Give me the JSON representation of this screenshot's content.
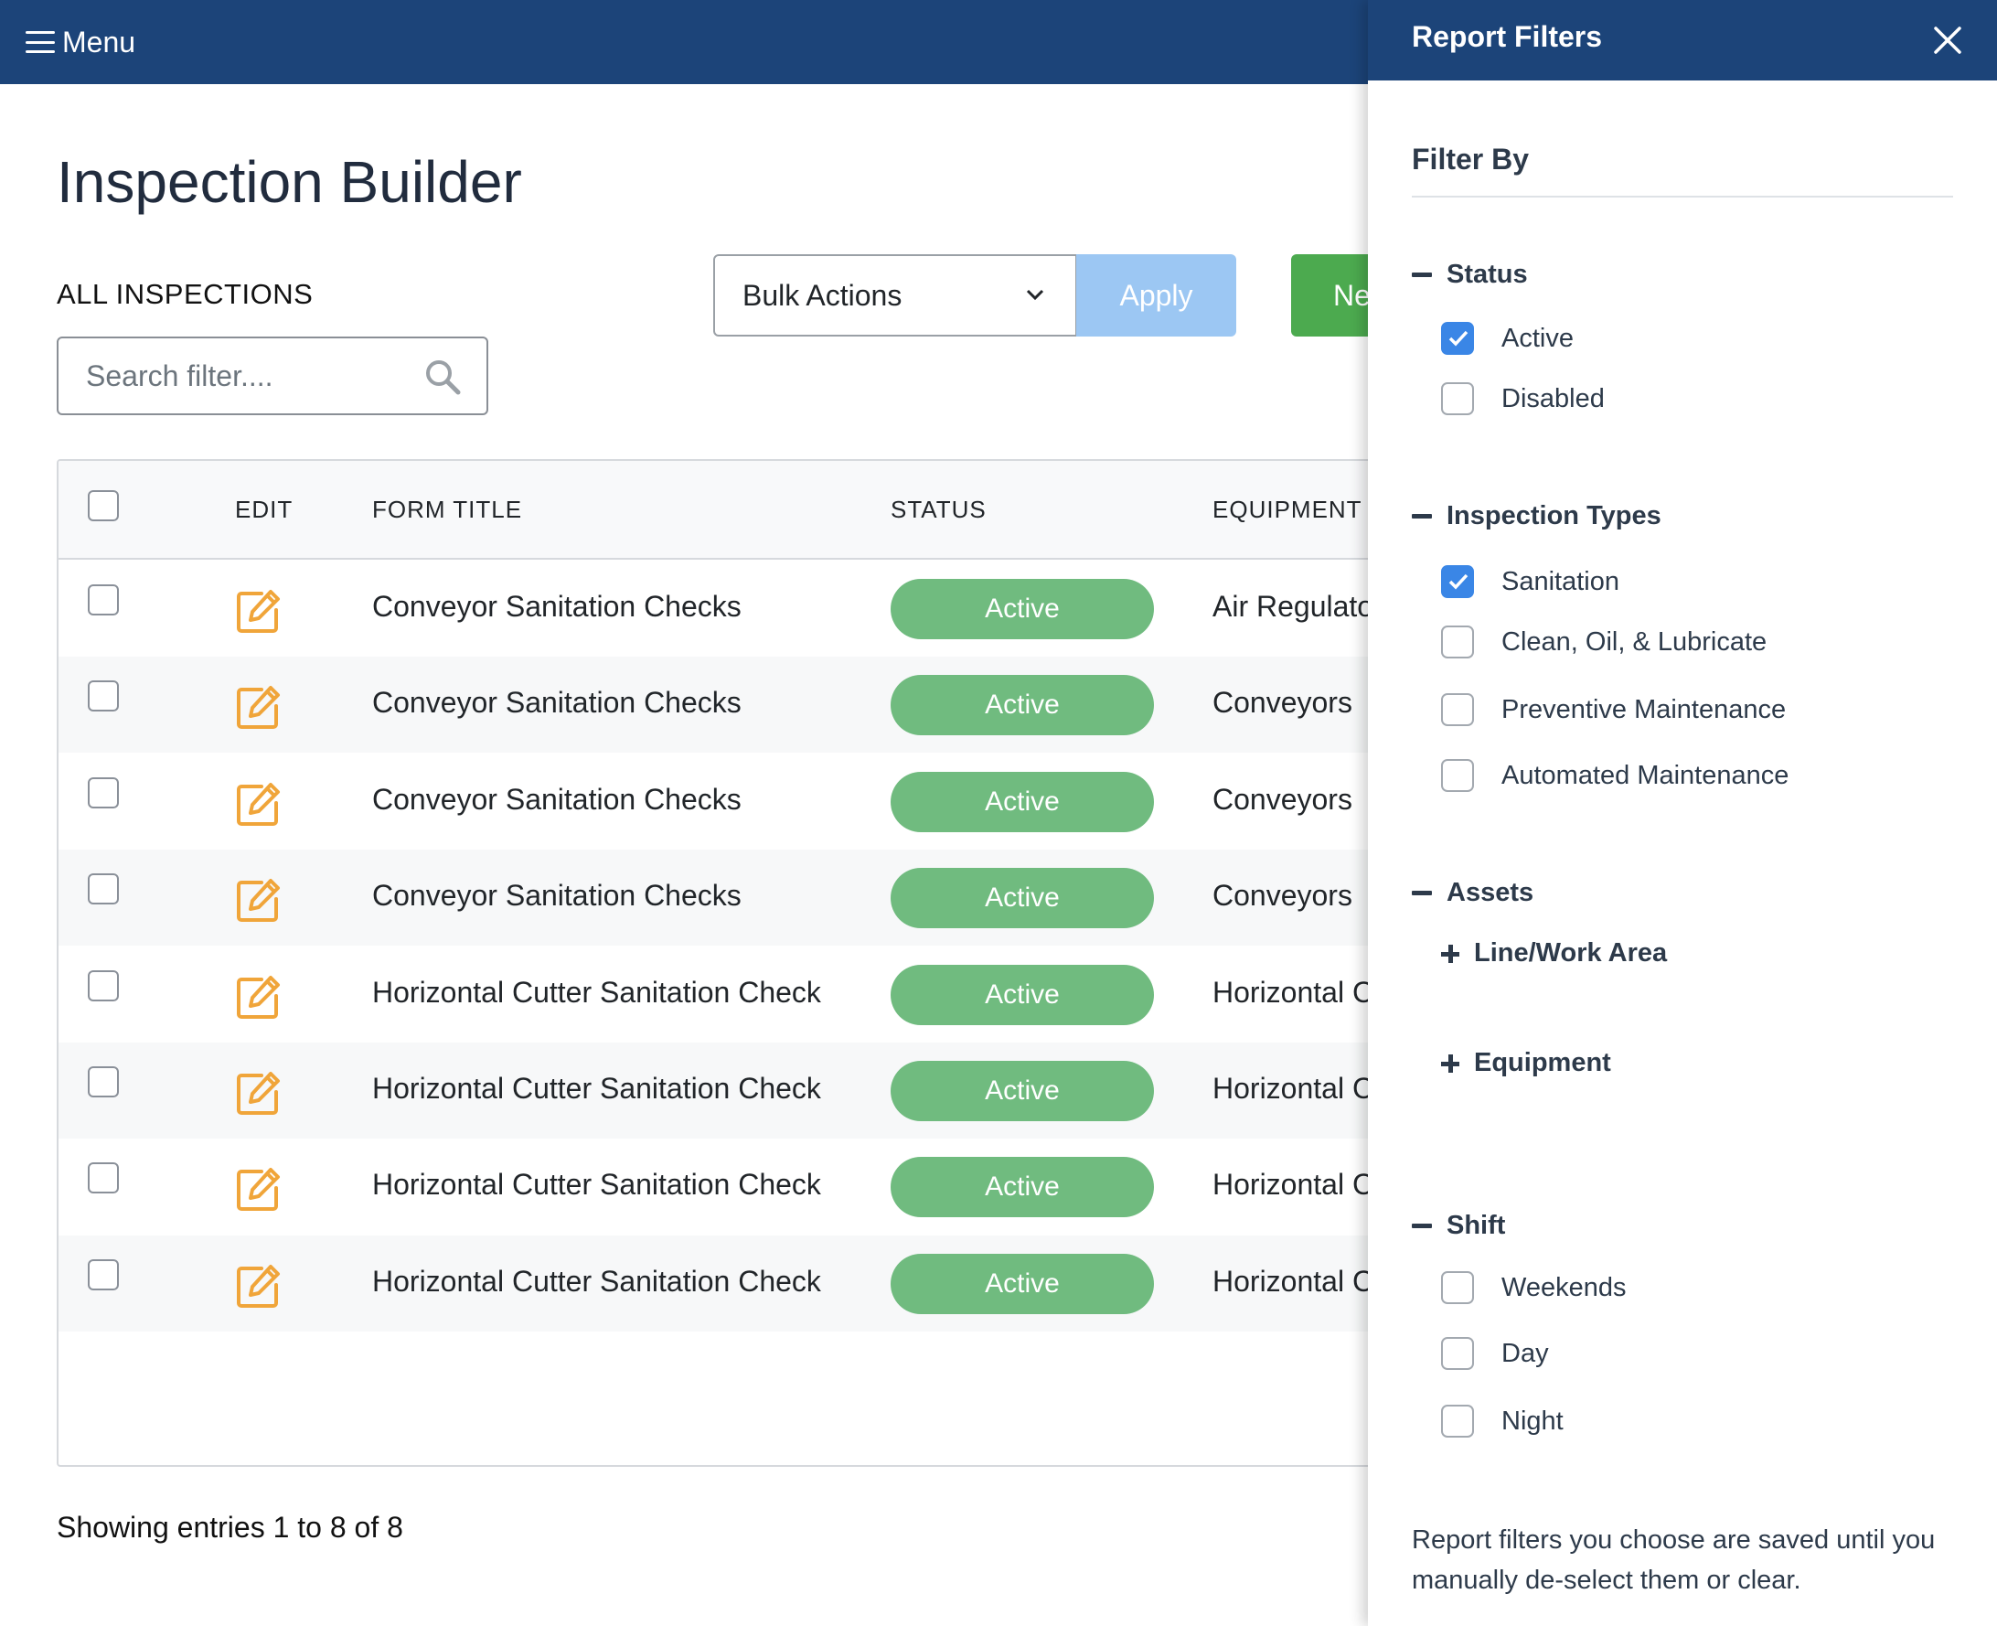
{
  "topbar": {
    "menu_label": "Menu",
    "bg_color": "#1c4479"
  },
  "page": {
    "title": "Inspection Builder",
    "section_label": "ALL INSPECTIONS",
    "search_placeholder": "Search filter....",
    "bulk_actions_label": "Bulk Actions",
    "apply_label": "Apply",
    "new_label": "Ne"
  },
  "table": {
    "headers": {
      "edit": "EDIT",
      "form_title": "FORM TITLE",
      "status": "STATUS",
      "equipment": "EQUIPMENT"
    },
    "rows": [
      {
        "title": "Conveyor Sanitation Checks",
        "status": "Active",
        "equipment": "Air Regulato"
      },
      {
        "title": "Conveyor Sanitation Checks",
        "status": "Active",
        "equipment": "Conveyors"
      },
      {
        "title": "Conveyor Sanitation Checks",
        "status": "Active",
        "equipment": "Conveyors"
      },
      {
        "title": "Conveyor Sanitation Checks",
        "status": "Active",
        "equipment": "Conveyors"
      },
      {
        "title": "Horizontal Cutter Sanitation Check",
        "status": "Active",
        "equipment": "Horizontal C"
      },
      {
        "title": "Horizontal Cutter Sanitation Check",
        "status": "Active",
        "equipment": "Horizontal C"
      },
      {
        "title": "Horizontal Cutter Sanitation Check",
        "status": "Active",
        "equipment": "Horizontal C"
      },
      {
        "title": "Horizontal Cutter Sanitation Check",
        "status": "Active",
        "equipment": "Horizontal C"
      }
    ],
    "footer": "Showing entries 1 to 8 of 8"
  },
  "panel": {
    "title": "Report Filters",
    "filter_by": "Filter By",
    "groups": {
      "status": {
        "label": "Status",
        "options": [
          {
            "label": "Active",
            "checked": true
          },
          {
            "label": "Disabled",
            "checked": false
          }
        ]
      },
      "inspection_types": {
        "label": "Inspection Types",
        "options": [
          {
            "label": "Sanitation",
            "checked": true
          },
          {
            "label": "Clean, Oil, & Lubricate",
            "checked": false
          },
          {
            "label": "Preventive Maintenance",
            "checked": false
          },
          {
            "label": "Automated Maintenance",
            "checked": false
          }
        ]
      },
      "assets": {
        "label": "Assets",
        "subgroups": [
          {
            "label": "Line/Work Area"
          },
          {
            "label": "Equipment"
          }
        ]
      },
      "shift": {
        "label": "Shift",
        "options": [
          {
            "label": "Weekends",
            "checked": false
          },
          {
            "label": "Day",
            "checked": false
          },
          {
            "label": "Night",
            "checked": false
          }
        ]
      }
    },
    "note": "Report filters you choose are saved until you manually de-select them or clear."
  },
  "colors": {
    "accent": "#1c4479",
    "status_active": "#70bb7f",
    "new_button": "#4caa4f",
    "apply_button": "#9cc7f3",
    "edit_icon": "#f0a53a",
    "checkbox_on": "#3a86e6"
  }
}
